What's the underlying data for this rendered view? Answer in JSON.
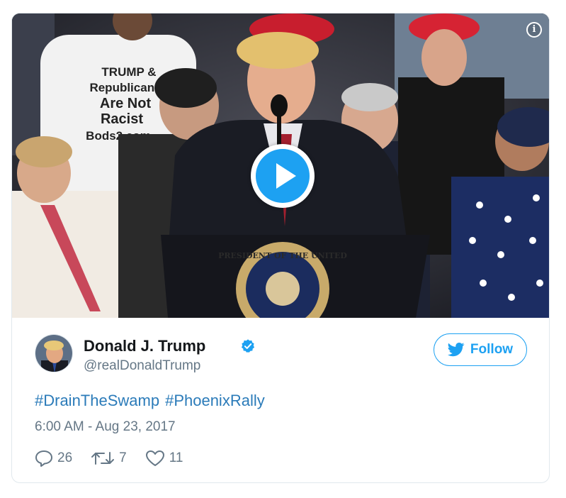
{
  "media": {
    "info_icon": "info-icon",
    "play_icon": "play-icon",
    "shirt_text": [
      "TRUMP &",
      "Republicans",
      "Are Not",
      "Racist",
      "Bods2.com"
    ],
    "seal_text": "PRESIDENT OF THE UNITED"
  },
  "author": {
    "name": "Donald J. Trump",
    "handle": "@realDonaldTrump",
    "verified_icon": "verified-badge-icon"
  },
  "follow": {
    "label": "Follow",
    "icon": "twitter-bird-icon"
  },
  "tweet": {
    "hashtags": [
      "#DrainTheSwamp",
      "#PhoenixRally"
    ],
    "timestamp": "6:00 AM - Aug 23, 2017"
  },
  "actions": {
    "replies": "26",
    "retweets": "7",
    "likes": "11"
  },
  "colors": {
    "link": "#2b7bb9",
    "accent": "#1da1f2",
    "muted": "#657786",
    "border": "#e1e8ed"
  }
}
